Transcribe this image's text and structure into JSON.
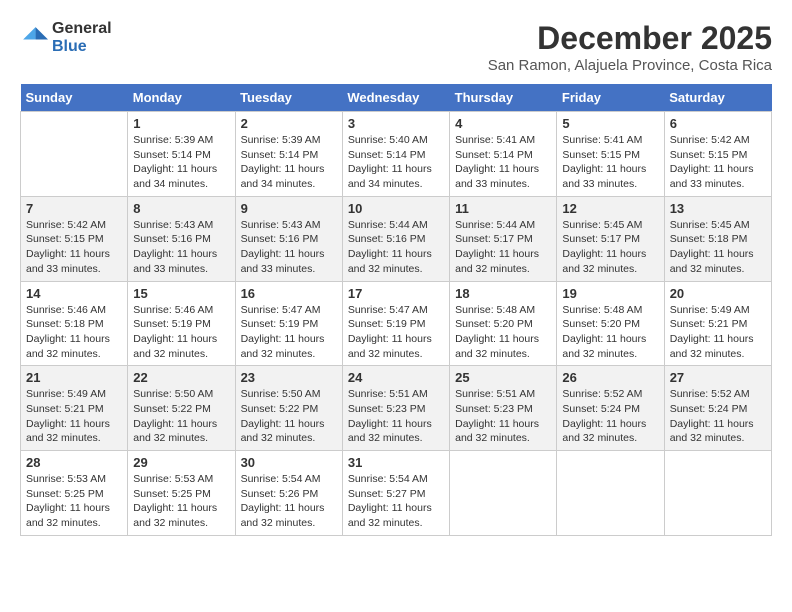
{
  "header": {
    "logo_general": "General",
    "logo_blue": "Blue",
    "title": "December 2025",
    "subtitle": "San Ramon, Alajuela Province, Costa Rica"
  },
  "days_of_week": [
    "Sunday",
    "Monday",
    "Tuesday",
    "Wednesday",
    "Thursday",
    "Friday",
    "Saturday"
  ],
  "weeks": [
    [
      {
        "day": null
      },
      {
        "day": "1",
        "sunrise": "Sunrise: 5:39 AM",
        "sunset": "Sunset: 5:14 PM",
        "daylight": "Daylight: 11 hours and 34 minutes."
      },
      {
        "day": "2",
        "sunrise": "Sunrise: 5:39 AM",
        "sunset": "Sunset: 5:14 PM",
        "daylight": "Daylight: 11 hours and 34 minutes."
      },
      {
        "day": "3",
        "sunrise": "Sunrise: 5:40 AM",
        "sunset": "Sunset: 5:14 PM",
        "daylight": "Daylight: 11 hours and 34 minutes."
      },
      {
        "day": "4",
        "sunrise": "Sunrise: 5:41 AM",
        "sunset": "Sunset: 5:14 PM",
        "daylight": "Daylight: 11 hours and 33 minutes."
      },
      {
        "day": "5",
        "sunrise": "Sunrise: 5:41 AM",
        "sunset": "Sunset: 5:15 PM",
        "daylight": "Daylight: 11 hours and 33 minutes."
      },
      {
        "day": "6",
        "sunrise": "Sunrise: 5:42 AM",
        "sunset": "Sunset: 5:15 PM",
        "daylight": "Daylight: 11 hours and 33 minutes."
      }
    ],
    [
      {
        "day": "7",
        "sunrise": "Sunrise: 5:42 AM",
        "sunset": "Sunset: 5:15 PM",
        "daylight": "Daylight: 11 hours and 33 minutes."
      },
      {
        "day": "8",
        "sunrise": "Sunrise: 5:43 AM",
        "sunset": "Sunset: 5:16 PM",
        "daylight": "Daylight: 11 hours and 33 minutes."
      },
      {
        "day": "9",
        "sunrise": "Sunrise: 5:43 AM",
        "sunset": "Sunset: 5:16 PM",
        "daylight": "Daylight: 11 hours and 33 minutes."
      },
      {
        "day": "10",
        "sunrise": "Sunrise: 5:44 AM",
        "sunset": "Sunset: 5:16 PM",
        "daylight": "Daylight: 11 hours and 32 minutes."
      },
      {
        "day": "11",
        "sunrise": "Sunrise: 5:44 AM",
        "sunset": "Sunset: 5:17 PM",
        "daylight": "Daylight: 11 hours and 32 minutes."
      },
      {
        "day": "12",
        "sunrise": "Sunrise: 5:45 AM",
        "sunset": "Sunset: 5:17 PM",
        "daylight": "Daylight: 11 hours and 32 minutes."
      },
      {
        "day": "13",
        "sunrise": "Sunrise: 5:45 AM",
        "sunset": "Sunset: 5:18 PM",
        "daylight": "Daylight: 11 hours and 32 minutes."
      }
    ],
    [
      {
        "day": "14",
        "sunrise": "Sunrise: 5:46 AM",
        "sunset": "Sunset: 5:18 PM",
        "daylight": "Daylight: 11 hours and 32 minutes."
      },
      {
        "day": "15",
        "sunrise": "Sunrise: 5:46 AM",
        "sunset": "Sunset: 5:19 PM",
        "daylight": "Daylight: 11 hours and 32 minutes."
      },
      {
        "day": "16",
        "sunrise": "Sunrise: 5:47 AM",
        "sunset": "Sunset: 5:19 PM",
        "daylight": "Daylight: 11 hours and 32 minutes."
      },
      {
        "day": "17",
        "sunrise": "Sunrise: 5:47 AM",
        "sunset": "Sunset: 5:19 PM",
        "daylight": "Daylight: 11 hours and 32 minutes."
      },
      {
        "day": "18",
        "sunrise": "Sunrise: 5:48 AM",
        "sunset": "Sunset: 5:20 PM",
        "daylight": "Daylight: 11 hours and 32 minutes."
      },
      {
        "day": "19",
        "sunrise": "Sunrise: 5:48 AM",
        "sunset": "Sunset: 5:20 PM",
        "daylight": "Daylight: 11 hours and 32 minutes."
      },
      {
        "day": "20",
        "sunrise": "Sunrise: 5:49 AM",
        "sunset": "Sunset: 5:21 PM",
        "daylight": "Daylight: 11 hours and 32 minutes."
      }
    ],
    [
      {
        "day": "21",
        "sunrise": "Sunrise: 5:49 AM",
        "sunset": "Sunset: 5:21 PM",
        "daylight": "Daylight: 11 hours and 32 minutes."
      },
      {
        "day": "22",
        "sunrise": "Sunrise: 5:50 AM",
        "sunset": "Sunset: 5:22 PM",
        "daylight": "Daylight: 11 hours and 32 minutes."
      },
      {
        "day": "23",
        "sunrise": "Sunrise: 5:50 AM",
        "sunset": "Sunset: 5:22 PM",
        "daylight": "Daylight: 11 hours and 32 minutes."
      },
      {
        "day": "24",
        "sunrise": "Sunrise: 5:51 AM",
        "sunset": "Sunset: 5:23 PM",
        "daylight": "Daylight: 11 hours and 32 minutes."
      },
      {
        "day": "25",
        "sunrise": "Sunrise: 5:51 AM",
        "sunset": "Sunset: 5:23 PM",
        "daylight": "Daylight: 11 hours and 32 minutes."
      },
      {
        "day": "26",
        "sunrise": "Sunrise: 5:52 AM",
        "sunset": "Sunset: 5:24 PM",
        "daylight": "Daylight: 11 hours and 32 minutes."
      },
      {
        "day": "27",
        "sunrise": "Sunrise: 5:52 AM",
        "sunset": "Sunset: 5:24 PM",
        "daylight": "Daylight: 11 hours and 32 minutes."
      }
    ],
    [
      {
        "day": "28",
        "sunrise": "Sunrise: 5:53 AM",
        "sunset": "Sunset: 5:25 PM",
        "daylight": "Daylight: 11 hours and 32 minutes."
      },
      {
        "day": "29",
        "sunrise": "Sunrise: 5:53 AM",
        "sunset": "Sunset: 5:25 PM",
        "daylight": "Daylight: 11 hours and 32 minutes."
      },
      {
        "day": "30",
        "sunrise": "Sunrise: 5:54 AM",
        "sunset": "Sunset: 5:26 PM",
        "daylight": "Daylight: 11 hours and 32 minutes."
      },
      {
        "day": "31",
        "sunrise": "Sunrise: 5:54 AM",
        "sunset": "Sunset: 5:27 PM",
        "daylight": "Daylight: 11 hours and 32 minutes."
      },
      {
        "day": null
      },
      {
        "day": null
      },
      {
        "day": null
      }
    ]
  ]
}
